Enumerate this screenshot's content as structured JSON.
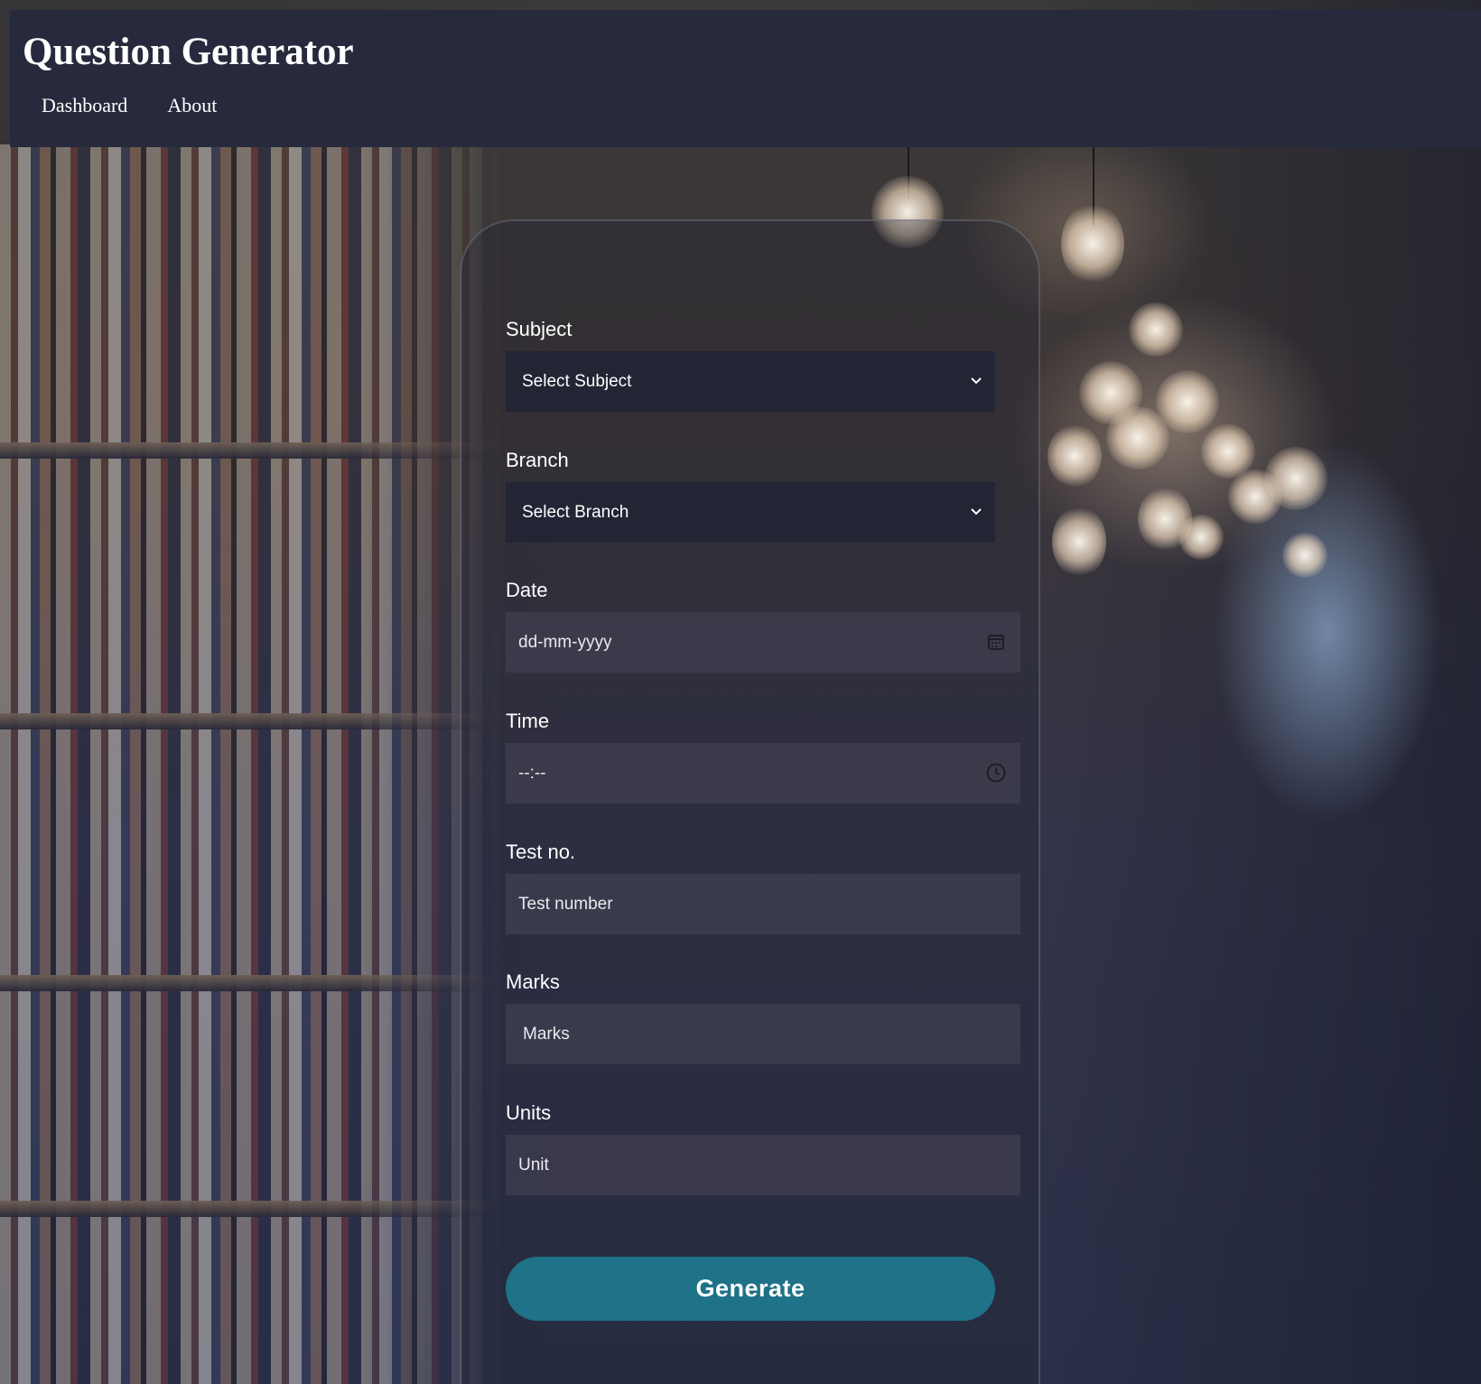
{
  "header": {
    "title": "Question Generator",
    "nav": [
      {
        "label": "Dashboard"
      },
      {
        "label": "About"
      }
    ]
  },
  "form": {
    "subject": {
      "label": "Subject",
      "value": "Select Subject",
      "icon": "chevron-down-icon"
    },
    "branch": {
      "label": "Branch",
      "value": "Select Branch",
      "icon": "chevron-down-icon"
    },
    "date": {
      "label": "Date",
      "placeholder": "dd-mm-yyyy",
      "icon": "calendar-icon"
    },
    "time": {
      "label": "Time",
      "placeholder": "--:--",
      "icon": "clock-icon"
    },
    "test_no": {
      "label": "Test no.",
      "placeholder": "Test number"
    },
    "marks": {
      "label": "Marks",
      "placeholder": "Marks"
    },
    "units": {
      "label": "Units",
      "placeholder": "Unit"
    },
    "submit_label": "Generate"
  },
  "colors": {
    "header_bg": "#272a3c",
    "select_bg": "#232535",
    "button_bg": "#1f7287"
  }
}
